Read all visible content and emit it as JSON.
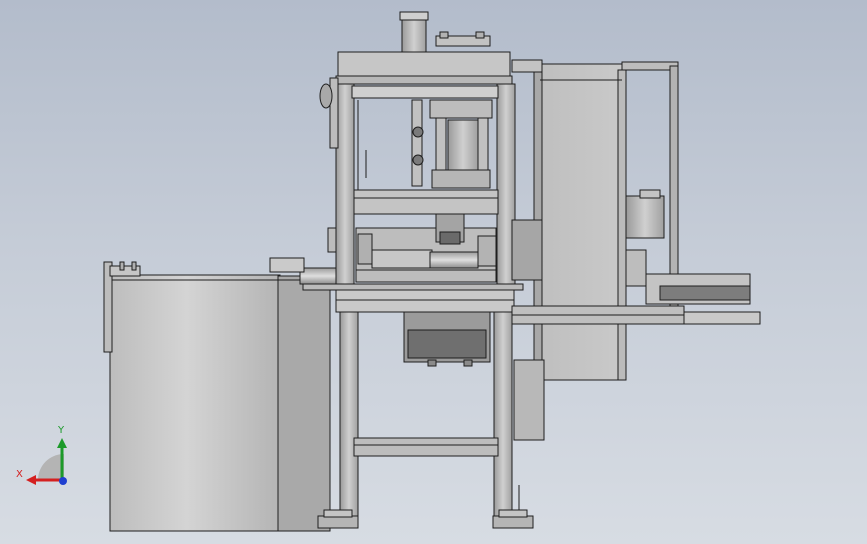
{
  "view": {
    "background_top": "#b3bccb",
    "background_bottom": "#d7dce3",
    "model_color": "#c8c8c8",
    "edge_color": "#1e1e1e"
  },
  "triad": {
    "x_label": "X",
    "y_label": "Y",
    "x_color": "#d42020",
    "y_color": "#1c9a2a",
    "z_color": "#1f3fd0"
  }
}
